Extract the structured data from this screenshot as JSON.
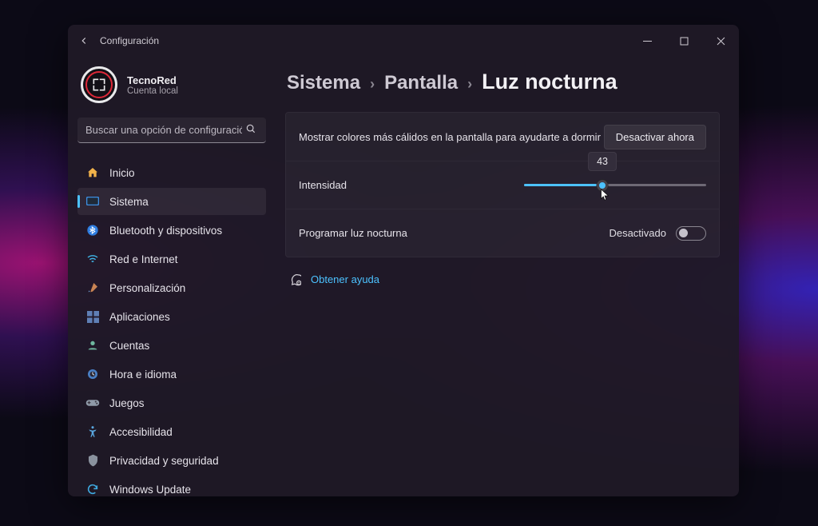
{
  "app_title": "Configuración",
  "profile": {
    "name": "TecnoRed",
    "account_type": "Cuenta local"
  },
  "search": {
    "placeholder": "Buscar una opción de configuración"
  },
  "sidebar": {
    "items": [
      {
        "icon": "home",
        "label": "Inicio"
      },
      {
        "icon": "system",
        "label": "Sistema"
      },
      {
        "icon": "bluetooth",
        "label": "Bluetooth y dispositivos"
      },
      {
        "icon": "wifi",
        "label": "Red e Internet"
      },
      {
        "icon": "brush",
        "label": "Personalización"
      },
      {
        "icon": "apps",
        "label": "Aplicaciones"
      },
      {
        "icon": "accounts",
        "label": "Cuentas"
      },
      {
        "icon": "time",
        "label": "Hora e idioma"
      },
      {
        "icon": "games",
        "label": "Juegos"
      },
      {
        "icon": "access",
        "label": "Accesibilidad"
      },
      {
        "icon": "privacy",
        "label": "Privacidad y seguridad"
      },
      {
        "icon": "update",
        "label": "Windows Update"
      }
    ],
    "active_index": 1
  },
  "breadcrumb": {
    "level1": "Sistema",
    "level2": "Pantalla",
    "level3": "Luz nocturna"
  },
  "panel": {
    "description": "Mostrar colores más cálidos en la pantalla para ayudarte a dormir",
    "toggle_now_button": "Desactivar ahora",
    "strength": {
      "label": "Intensidad",
      "value": 43,
      "min": 0,
      "max": 100
    },
    "schedule": {
      "label": "Programar luz nocturna",
      "state_label": "Desactivado",
      "enabled": false
    }
  },
  "help_link": "Obtener ayuda"
}
